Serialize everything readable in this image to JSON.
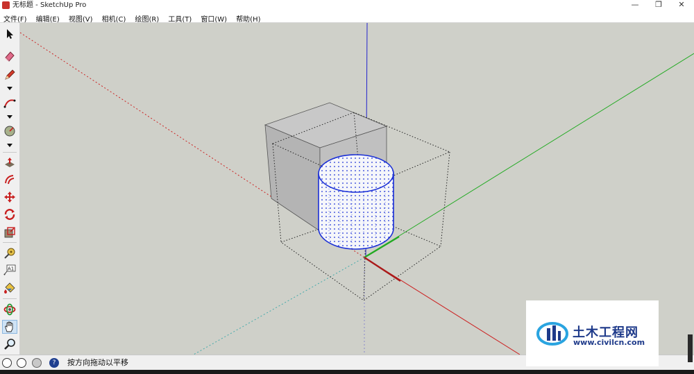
{
  "window": {
    "title": "无标题 - SketchUp Pro",
    "minimize": "—",
    "restore": "❐",
    "close": "✕"
  },
  "menu": [
    "文件(F)",
    "编辑(E)",
    "视图(V)",
    "相机(C)",
    "绘图(R)",
    "工具(T)",
    "窗口(W)",
    "帮助(H)"
  ],
  "toolbar": [
    {
      "name": "select-tool",
      "icon": "arrow-icon"
    },
    {
      "name": "eraser-tool",
      "icon": "eraser-icon"
    },
    {
      "name": "line-tool",
      "icon": "pencil-icon",
      "dropdown": true
    },
    {
      "name": "arc-tool",
      "icon": "arc-icon",
      "dropdown": true
    },
    {
      "name": "shape-tool",
      "icon": "shape-icon",
      "dropdown": true
    },
    {
      "name": "push-pull-tool",
      "icon": "push-pull-icon"
    },
    {
      "name": "offset-tool",
      "icon": "offset-icon"
    },
    {
      "name": "move-tool",
      "icon": "move-icon"
    },
    {
      "name": "rotate-tool",
      "icon": "rotate-icon"
    },
    {
      "name": "scale-tool",
      "icon": "scale-icon"
    },
    {
      "name": "tape-measure-tool",
      "icon": "tape-measure-icon"
    },
    {
      "name": "text-tool",
      "icon": "text-label-icon",
      "label": "A1"
    },
    {
      "name": "paint-bucket-tool",
      "icon": "paint-bucket-icon"
    },
    {
      "name": "orbit-tool",
      "icon": "orbit-icon"
    },
    {
      "name": "pan-tool",
      "icon": "hand-icon",
      "active": true
    },
    {
      "name": "zoom-tool",
      "icon": "magnifier-icon"
    }
  ],
  "status": {
    "icons": [
      "geolocation-icon",
      "credits-icon",
      "user-icon",
      "help-icon"
    ],
    "message": "按方向拖动以平移"
  },
  "watermark": {
    "cn": "土木工程网",
    "url": "www.civilcn.com"
  },
  "colors": {
    "viewport_bg": "#cfd0c9",
    "axis_red": "#cc2222",
    "axis_green": "#22aa22",
    "axis_blue": "#2222cc",
    "selection_blue": "#1a2fd6"
  }
}
